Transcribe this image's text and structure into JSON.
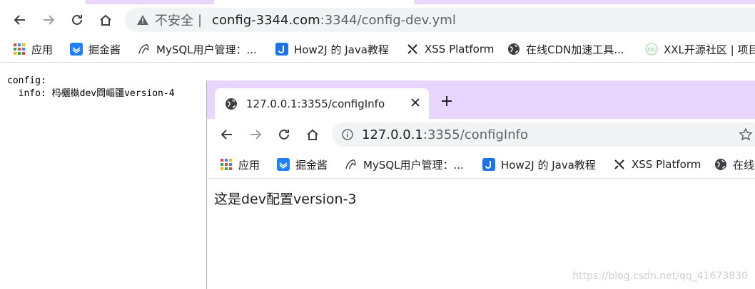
{
  "outer": {
    "omnibox": {
      "insecure_label": "不安全",
      "separator": "|",
      "url_host": "config-3344.com",
      "url_rest": ":3344/config-dev.yml"
    },
    "bookmarks": [
      {
        "label": "应用",
        "icon": "apps-grid-icon"
      },
      {
        "label": "掘金酱",
        "icon": "juejin-icon"
      },
      {
        "label": "MySQL用户管理：...",
        "icon": "mysql-dolphin-icon"
      },
      {
        "label": "How2J 的 Java教程",
        "icon": "how2j-icon"
      },
      {
        "label": "XSS Platform",
        "icon": "xss-icon"
      },
      {
        "label": "在线CDN加速工具...",
        "icon": "globe-icon"
      },
      {
        "label": "XXL开源社区 | 项目",
        "icon": "xxl-icon"
      }
    ]
  },
  "yaml": {
    "line1": "config:",
    "line2": "  info: 杩欐槸dev閰嶇疆version-4"
  },
  "inner": {
    "tab_title": "127.0.0.1:3355/configInfo",
    "omnibox": {
      "url_host": "127.0.0.1",
      "url_rest": ":3355/configInfo"
    },
    "bookmarks": [
      {
        "label": "应用",
        "icon": "apps-grid-icon"
      },
      {
        "label": "掘金酱",
        "icon": "juejin-icon"
      },
      {
        "label": "MySQL用户管理：...",
        "icon": "mysql-dolphin-icon"
      },
      {
        "label": "How2J 的 Java教程",
        "icon": "how2j-icon"
      },
      {
        "label": "XSS Platform",
        "icon": "xss-icon"
      },
      {
        "label": "在线",
        "icon": "globe-icon"
      }
    ],
    "content_text": "这是dev配置version-3"
  },
  "watermark": "https://blog.csdn.net/qq_41673830",
  "colors": {
    "tab_strip": "#e9d6ff",
    "omnibox_bg": "#f1f3f4",
    "text_primary": "#202124",
    "text_secondary": "#5f6368"
  }
}
